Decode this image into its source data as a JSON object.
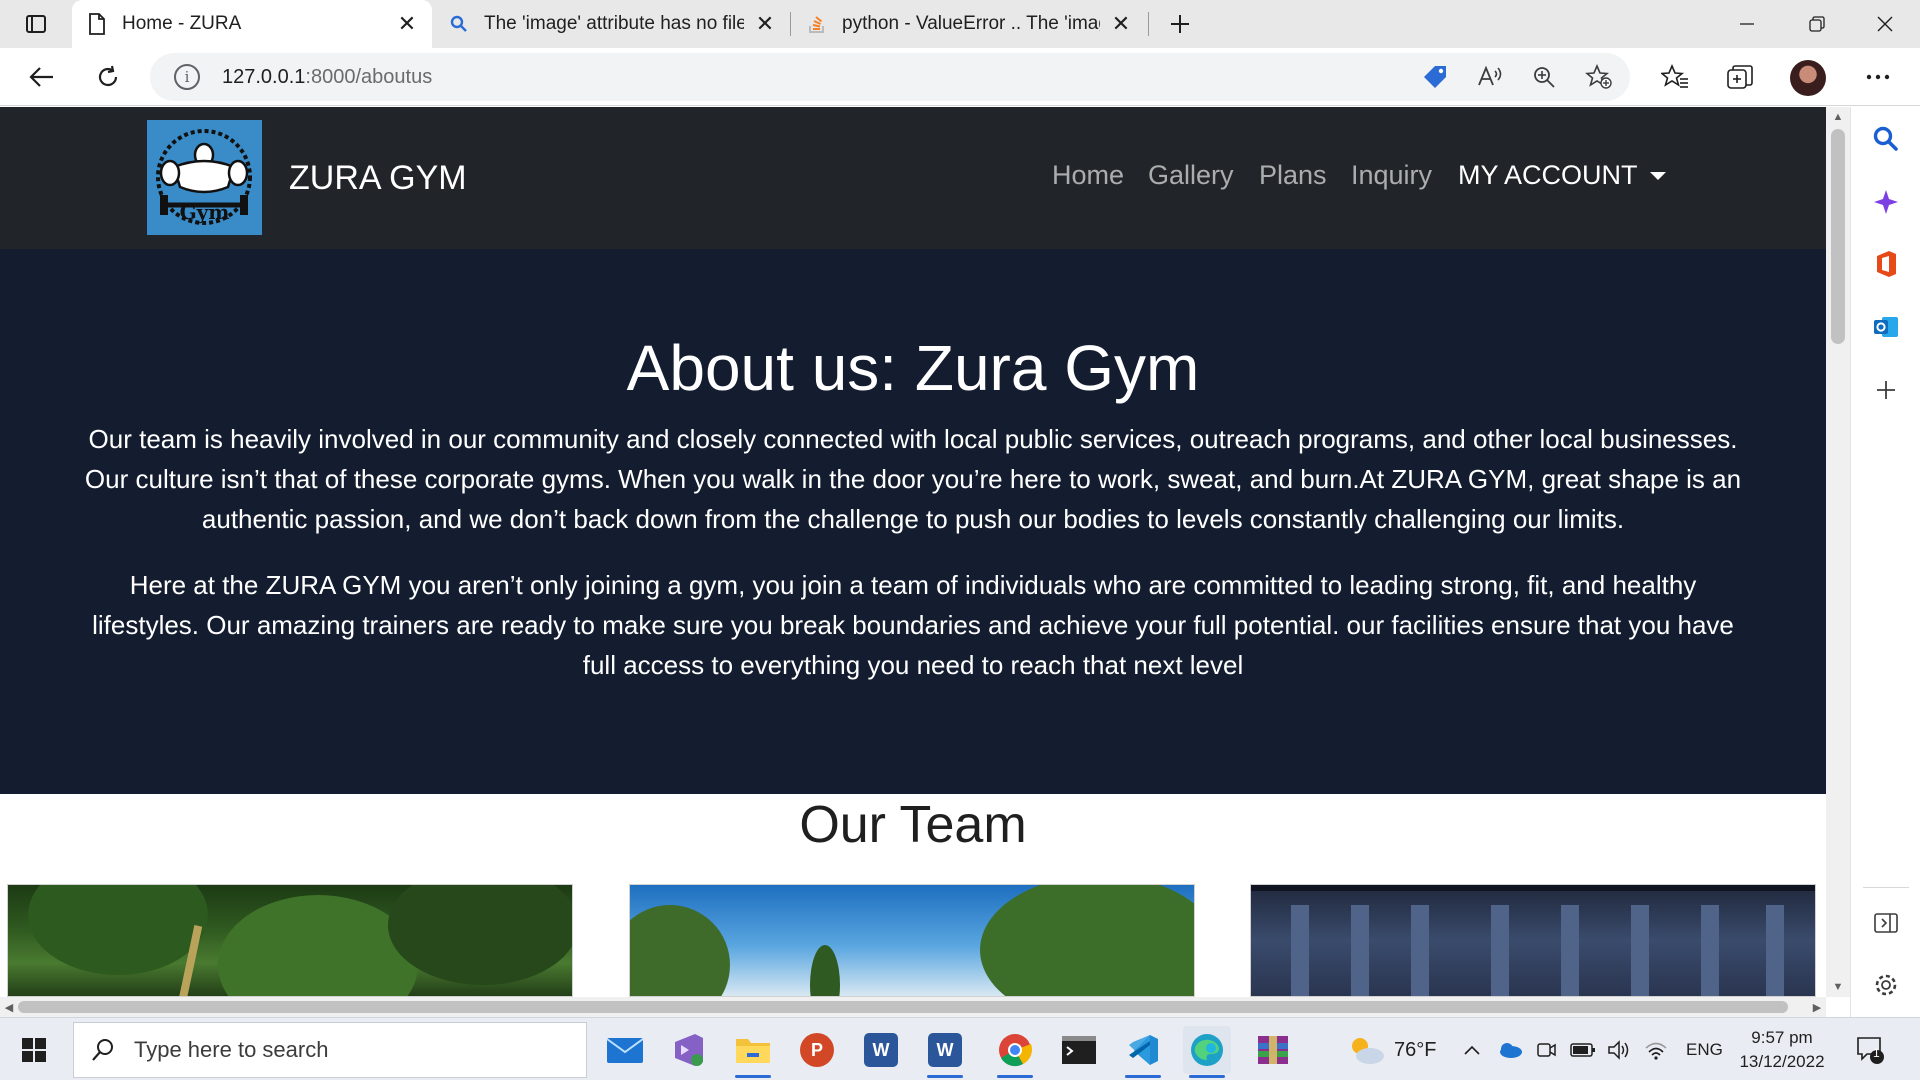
{
  "browser": {
    "tabs": [
      {
        "title": "Home - ZURA",
        "active": true
      },
      {
        "title": "The 'image' attribute has no file a",
        "active": false
      },
      {
        "title": "python - ValueError .. The 'image'",
        "active": false
      }
    ],
    "url_host": "127.0.0.1",
    "url_path": ":8000/aboutus"
  },
  "site": {
    "brand": "ZURA GYM",
    "logo_text": "Gym",
    "nav": [
      "Home",
      "Gallery",
      "Plans",
      "Inquiry"
    ],
    "account_label": "MY ACCOUNT"
  },
  "hero": {
    "title": "About us: Zura Gym",
    "paragraph1": "Our team is heavily involved in our community and closely connected with local public services, outreach programs, and other local businesses. Our culture isn’t that of these corporate gyms. When you walk in the door you’re here to work, sweat, and burn.At ZURA GYM, great shape is an authentic passion, and we don’t back down from the challenge to push our bodies to levels constantly challenging our limits.",
    "paragraph2": "Here at the ZURA GYM you aren’t only joining a gym, you join a team of individuals who are committed to leading strong, fit, and healthy lifestyles. Our amazing trainers are ready to make sure you break boundaries and achieve your full potential. our facilities ensure that you have full access to everything you need to reach that next level"
  },
  "team": {
    "title": "Our Team"
  },
  "taskbar": {
    "search_placeholder": "Type here to search",
    "weather": "76°F",
    "language": "ENG",
    "time": "9:57 pm",
    "date": "13/12/2022",
    "notification_count": "1"
  },
  "colors": {
    "navbar": "#212529",
    "hero": "#141d30",
    "logo_bg": "#3a8cc9"
  }
}
